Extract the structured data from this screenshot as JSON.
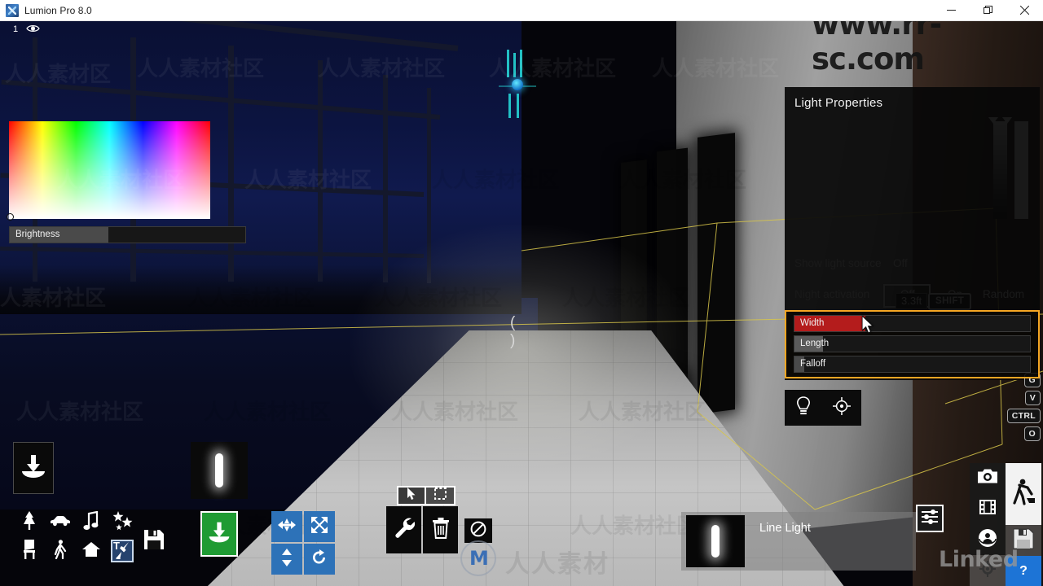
{
  "window": {
    "title": "Lumion Pro 8.0",
    "app_icon": "lumion-icon",
    "minimize": "minimize-icon",
    "maximize": "maximize-icon",
    "close": "close-icon"
  },
  "scene_badge": {
    "number": "1",
    "eye_icon": "eye-icon"
  },
  "light_properties": {
    "title": "Light Properties",
    "color_picker": {
      "name": "hue-saturation-field",
      "value_slider": "value-slider",
      "preview_swatch": "#ffffff"
    },
    "brightness": {
      "label": "Brightness",
      "fill_percent": 42,
      "fill_color": "#4a4a4a"
    },
    "show_light_source": {
      "label": "Show light source",
      "value": "Off"
    },
    "night_activation": {
      "label": "Night activation",
      "option_off": "Off",
      "option_on": "On",
      "option_random": "Random",
      "selected": "Off"
    },
    "tooltip_value": "3.3ft",
    "shift_badge": "SHIFT",
    "highlight_color": "#f5a623",
    "sliders": [
      {
        "label": "Width",
        "fill_percent": 30,
        "fill_color": "#b41c1c"
      },
      {
        "label": "Length",
        "fill_percent": 12,
        "fill_color": "#5a5a5a"
      },
      {
        "label": "Falloff",
        "fill_percent": 4,
        "fill_color": "#4a4a4a"
      }
    ]
  },
  "keyboard_badges": [
    "G",
    "V",
    "CTRL",
    "O"
  ],
  "light_mini_panel": {
    "bulb_icon": "light-bulb-icon",
    "target_icon": "target-crosshair-icon"
  },
  "left_toolbar": {
    "place_object_icon": "place-object-icon",
    "categories": [
      {
        "name": "nature",
        "icon": "tree-icon",
        "active": false
      },
      {
        "name": "transport",
        "icon": "car-icon",
        "active": false
      },
      {
        "name": "sound",
        "icon": "music-note-icon",
        "active": false
      },
      {
        "name": "effects",
        "icon": "stars-icon",
        "active": false
      },
      {
        "name": "indoor",
        "icon": "chair-icon",
        "active": false
      },
      {
        "name": "people",
        "icon": "person-icon",
        "active": false
      },
      {
        "name": "outdoor",
        "icon": "house-icon",
        "active": false
      },
      {
        "name": "utilities",
        "icon": "text-wrench-icon",
        "active": true
      }
    ],
    "save_icon": "floppy-save-icon"
  },
  "center_toolbar": {
    "place_button_icon": "place-green-icon",
    "transform_tools": [
      {
        "name": "move",
        "icon": "move-arrows-icon"
      },
      {
        "name": "scale",
        "icon": "scale-arrows-icon"
      },
      {
        "name": "height",
        "icon": "height-arrows-icon"
      },
      {
        "name": "rotate",
        "icon": "rotate-icon"
      }
    ],
    "tool_tabs": [
      {
        "name": "select-pointer",
        "icon": "cursor-arrow-icon",
        "active": true
      },
      {
        "name": "marquee-select",
        "icon": "marquee-select-icon",
        "active": false
      }
    ],
    "context_tools": [
      {
        "name": "properties",
        "icon": "wrench-icon"
      },
      {
        "name": "delete",
        "icon": "trash-icon"
      }
    ],
    "disabled_tool": {
      "name": "no-action",
      "icon": "no-entry-icon"
    }
  },
  "info_bar": {
    "object_name": "Line Light",
    "thumbnail": "line-light-thumbnail",
    "settings_icon": "sliders-icon"
  },
  "mode_panel": {
    "items": [
      {
        "name": "photo-mode",
        "icon": "camera-icon",
        "active": false
      },
      {
        "name": "build-mode",
        "icon": "worker-icon",
        "active": true
      },
      {
        "name": "movie-mode",
        "icon": "film-strip-icon",
        "active": false
      },
      {
        "name": "save-scene",
        "icon": "floppy-save-icon",
        "active": false
      },
      {
        "name": "panorama-mode",
        "icon": "panorama-icon",
        "active": false
      },
      {
        "name": "help",
        "icon": "question-mark-icon",
        "label": "?",
        "active": false
      }
    ]
  },
  "watermarks": {
    "top_right": "www.rr-sc.com",
    "bottom_center": "人人素材",
    "bottom_right": "Linked",
    "tiled": "人人素材社区"
  }
}
